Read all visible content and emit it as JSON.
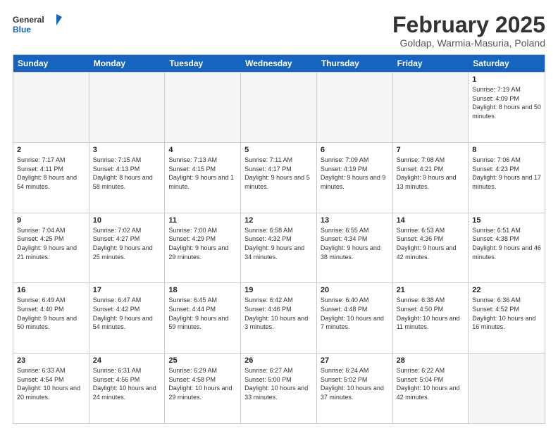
{
  "logo": {
    "general": "General",
    "blue": "Blue"
  },
  "title": "February 2025",
  "subtitle": "Goldap, Warmia-Masuria, Poland",
  "days_of_week": [
    "Sunday",
    "Monday",
    "Tuesday",
    "Wednesday",
    "Thursday",
    "Friday",
    "Saturday"
  ],
  "weeks": [
    [
      {
        "day": "",
        "info": ""
      },
      {
        "day": "",
        "info": ""
      },
      {
        "day": "",
        "info": ""
      },
      {
        "day": "",
        "info": ""
      },
      {
        "day": "",
        "info": ""
      },
      {
        "day": "",
        "info": ""
      },
      {
        "day": "1",
        "info": "Sunrise: 7:19 AM\nSunset: 4:09 PM\nDaylight: 8 hours and 50 minutes."
      }
    ],
    [
      {
        "day": "2",
        "info": "Sunrise: 7:17 AM\nSunset: 4:11 PM\nDaylight: 8 hours and 54 minutes."
      },
      {
        "day": "3",
        "info": "Sunrise: 7:15 AM\nSunset: 4:13 PM\nDaylight: 8 hours and 58 minutes."
      },
      {
        "day": "4",
        "info": "Sunrise: 7:13 AM\nSunset: 4:15 PM\nDaylight: 9 hours and 1 minute."
      },
      {
        "day": "5",
        "info": "Sunrise: 7:11 AM\nSunset: 4:17 PM\nDaylight: 9 hours and 5 minutes."
      },
      {
        "day": "6",
        "info": "Sunrise: 7:09 AM\nSunset: 4:19 PM\nDaylight: 9 hours and 9 minutes."
      },
      {
        "day": "7",
        "info": "Sunrise: 7:08 AM\nSunset: 4:21 PM\nDaylight: 9 hours and 13 minutes."
      },
      {
        "day": "8",
        "info": "Sunrise: 7:06 AM\nSunset: 4:23 PM\nDaylight: 9 hours and 17 minutes."
      }
    ],
    [
      {
        "day": "9",
        "info": "Sunrise: 7:04 AM\nSunset: 4:25 PM\nDaylight: 9 hours and 21 minutes."
      },
      {
        "day": "10",
        "info": "Sunrise: 7:02 AM\nSunset: 4:27 PM\nDaylight: 9 hours and 25 minutes."
      },
      {
        "day": "11",
        "info": "Sunrise: 7:00 AM\nSunset: 4:29 PM\nDaylight: 9 hours and 29 minutes."
      },
      {
        "day": "12",
        "info": "Sunrise: 6:58 AM\nSunset: 4:32 PM\nDaylight: 9 hours and 34 minutes."
      },
      {
        "day": "13",
        "info": "Sunrise: 6:55 AM\nSunset: 4:34 PM\nDaylight: 9 hours and 38 minutes."
      },
      {
        "day": "14",
        "info": "Sunrise: 6:53 AM\nSunset: 4:36 PM\nDaylight: 9 hours and 42 minutes."
      },
      {
        "day": "15",
        "info": "Sunrise: 6:51 AM\nSunset: 4:38 PM\nDaylight: 9 hours and 46 minutes."
      }
    ],
    [
      {
        "day": "16",
        "info": "Sunrise: 6:49 AM\nSunset: 4:40 PM\nDaylight: 9 hours and 50 minutes."
      },
      {
        "day": "17",
        "info": "Sunrise: 6:47 AM\nSunset: 4:42 PM\nDaylight: 9 hours and 54 minutes."
      },
      {
        "day": "18",
        "info": "Sunrise: 6:45 AM\nSunset: 4:44 PM\nDaylight: 9 hours and 59 minutes."
      },
      {
        "day": "19",
        "info": "Sunrise: 6:42 AM\nSunset: 4:46 PM\nDaylight: 10 hours and 3 minutes."
      },
      {
        "day": "20",
        "info": "Sunrise: 6:40 AM\nSunset: 4:48 PM\nDaylight: 10 hours and 7 minutes."
      },
      {
        "day": "21",
        "info": "Sunrise: 6:38 AM\nSunset: 4:50 PM\nDaylight: 10 hours and 11 minutes."
      },
      {
        "day": "22",
        "info": "Sunrise: 6:36 AM\nSunset: 4:52 PM\nDaylight: 10 hours and 16 minutes."
      }
    ],
    [
      {
        "day": "23",
        "info": "Sunrise: 6:33 AM\nSunset: 4:54 PM\nDaylight: 10 hours and 20 minutes."
      },
      {
        "day": "24",
        "info": "Sunrise: 6:31 AM\nSunset: 4:56 PM\nDaylight: 10 hours and 24 minutes."
      },
      {
        "day": "25",
        "info": "Sunrise: 6:29 AM\nSunset: 4:58 PM\nDaylight: 10 hours and 29 minutes."
      },
      {
        "day": "26",
        "info": "Sunrise: 6:27 AM\nSunset: 5:00 PM\nDaylight: 10 hours and 33 minutes."
      },
      {
        "day": "27",
        "info": "Sunrise: 6:24 AM\nSunset: 5:02 PM\nDaylight: 10 hours and 37 minutes."
      },
      {
        "day": "28",
        "info": "Sunrise: 6:22 AM\nSunset: 5:04 PM\nDaylight: 10 hours and 42 minutes."
      },
      {
        "day": "",
        "info": ""
      }
    ]
  ]
}
